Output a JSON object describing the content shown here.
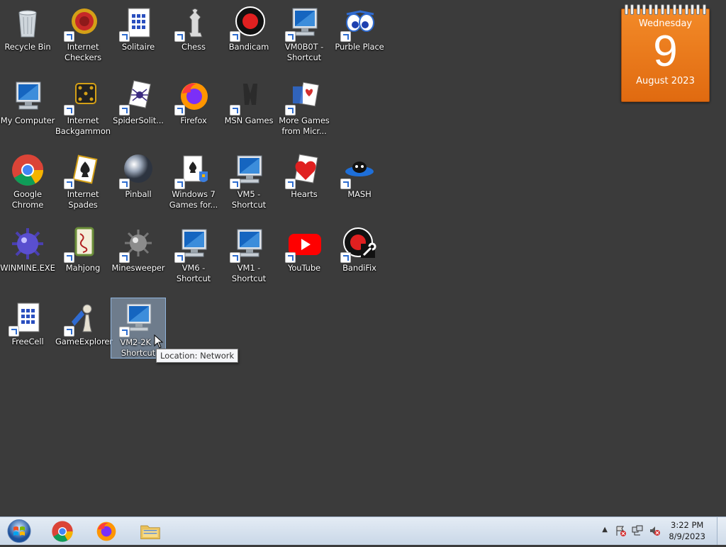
{
  "desktop": {
    "icons": [
      {
        "label": "Recycle Bin",
        "icon": "recycle-bin-icon",
        "shortcut": false
      },
      {
        "label": "Internet\nCheckers",
        "icon": "checkers-icon",
        "shortcut": true
      },
      {
        "label": "Solitaire",
        "icon": "solitaire-icon",
        "shortcut": true
      },
      {
        "label": "Chess",
        "icon": "chess-icon",
        "shortcut": true
      },
      {
        "label": "Bandicam",
        "icon": "bandicam-icon",
        "shortcut": true
      },
      {
        "label": "VM0B0T -\nShortcut",
        "icon": "computer-icon",
        "shortcut": true
      },
      {
        "label": "Purble Place",
        "icon": "purble-place-icon",
        "shortcut": true
      },
      {
        "label": "My Computer",
        "icon": "computer-icon",
        "shortcut": false
      },
      {
        "label": "Internet\nBackgammon",
        "icon": "backgammon-icon",
        "shortcut": true
      },
      {
        "label": "SpiderSolit...",
        "icon": "spider-solitaire-icon",
        "shortcut": true
      },
      {
        "label": "Firefox",
        "icon": "firefox-icon",
        "shortcut": true
      },
      {
        "label": "MSN Games",
        "icon": "msn-games-icon",
        "shortcut": true
      },
      {
        "label": "More Games\nfrom Micr...",
        "icon": "more-games-icon",
        "shortcut": true
      },
      {
        "label": "Google\nChrome",
        "icon": "chrome-icon",
        "shortcut": false
      },
      {
        "label": "Internet\nSpades",
        "icon": "spades-icon",
        "shortcut": true
      },
      {
        "label": "Pinball",
        "icon": "pinball-icon",
        "shortcut": true
      },
      {
        "label": "Windows 7\nGames for...",
        "icon": "windows7-games-icon",
        "shortcut": true
      },
      {
        "label": "VM5 -\nShortcut",
        "icon": "computer-icon",
        "shortcut": true
      },
      {
        "label": "Hearts",
        "icon": "hearts-icon",
        "shortcut": true
      },
      {
        "label": "MASH",
        "icon": "mash-icon",
        "shortcut": true
      },
      {
        "label": "WINMINE.EXE",
        "icon": "mine-icon",
        "shortcut": false
      },
      {
        "label": "Mahjong",
        "icon": "mahjong-icon",
        "shortcut": true
      },
      {
        "label": "Minesweeper",
        "icon": "minesweeper-icon",
        "shortcut": true
      },
      {
        "label": "VM6 -\nShortcut",
        "icon": "computer-icon",
        "shortcut": true
      },
      {
        "label": "VM1 -\nShortcut",
        "icon": "computer-icon",
        "shortcut": true
      },
      {
        "label": "YouTube",
        "icon": "youtube-icon",
        "shortcut": true
      },
      {
        "label": "BandiFix",
        "icon": "bandifix-icon",
        "shortcut": true
      },
      {
        "label": "FreeCell",
        "icon": "freecell-icon",
        "shortcut": true
      },
      {
        "label": "GameExplorer",
        "icon": "game-explorer-icon",
        "shortcut": true
      },
      {
        "label": "VM2-2K -\nShortcut",
        "icon": "computer-icon",
        "shortcut": true,
        "selected": true
      }
    ]
  },
  "tooltip": {
    "text": "Location: Network"
  },
  "calendar": {
    "weekday": "Wednesday",
    "day": "9",
    "month_year": "August 2023"
  },
  "taskbar": {
    "pinned": [
      {
        "name": "chrome",
        "icon": "chrome-icon"
      },
      {
        "name": "firefox",
        "icon": "firefox-icon"
      },
      {
        "name": "explorer",
        "icon": "folder-icon"
      }
    ],
    "clock": {
      "time": "3:22 PM",
      "date": "8/9/2023"
    }
  }
}
